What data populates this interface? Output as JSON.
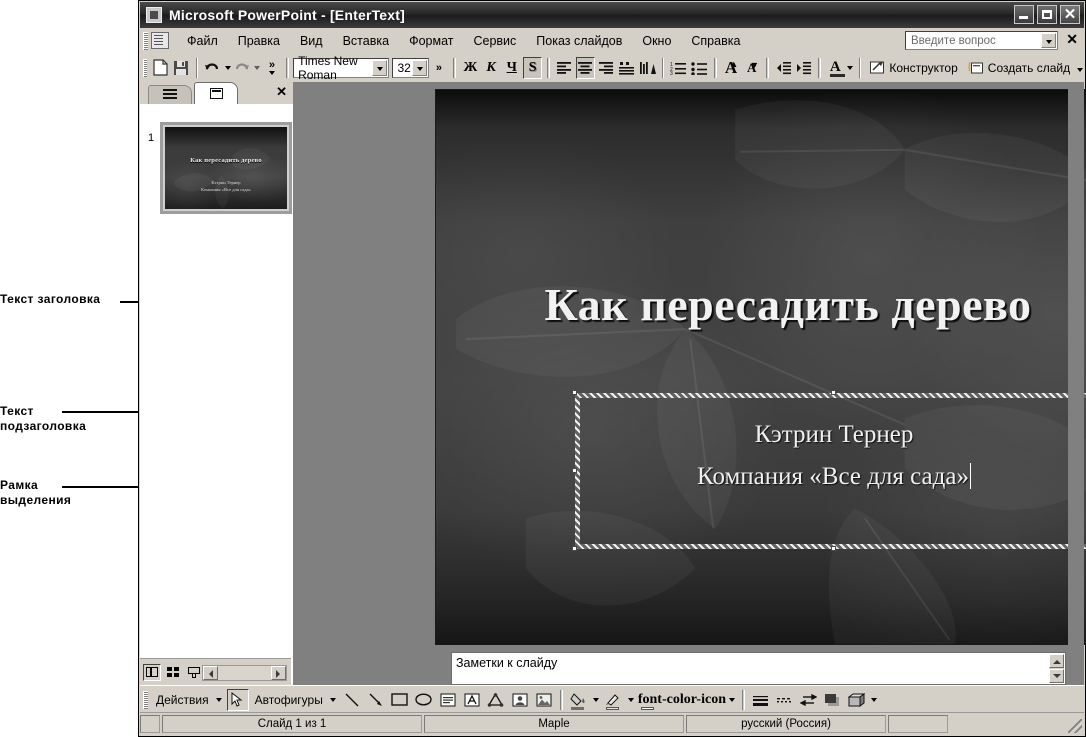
{
  "window": {
    "title": "Microsoft PowerPoint - [EnterText]",
    "app_icon": "powerpoint-icon",
    "minimize": "_",
    "maximize": "□",
    "close": "✕"
  },
  "menu": {
    "items": [
      {
        "label": "Файл"
      },
      {
        "label": "Правка"
      },
      {
        "label": "Вид"
      },
      {
        "label": "Вставка"
      },
      {
        "label": "Формат"
      },
      {
        "label": "Сервис"
      },
      {
        "label": "Показ слайдов"
      },
      {
        "label": "Окно"
      },
      {
        "label": "Справка"
      }
    ],
    "ask_box_placeholder": "Введите вопрос",
    "close_label": "✕"
  },
  "toolbar": {
    "new_icon": "new-document-icon",
    "save_icon": "save-icon",
    "undo_icon": "undo-icon",
    "redo_icon": "redo-icon",
    "overflow_label": "»",
    "font_name": "Times New Roman",
    "font_size": "32",
    "bold_label": "Ж",
    "italic_label": "К",
    "underline_label": "Ч",
    "shadow_label": "S",
    "align_left_icon": "align-left-icon",
    "align_center_icon": "align-center-icon",
    "align_right_icon": "align-right-icon",
    "line_spacing_icon": "line-spacing-icon",
    "text_direction_icon": "text-direction-icon",
    "numbered_list_icon": "numbered-list-icon",
    "bulleted_list_icon": "bulleted-list-icon",
    "increase_font_label": "A",
    "decrease_font_label": "A",
    "decrease_indent_icon": "decrease-indent-icon",
    "increase_indent_icon": "increase-indent-icon",
    "font_color_label": "A",
    "design_label": "Конструктор",
    "new_slide_label": "Создать слайд"
  },
  "left_pane": {
    "tab_outline_icon": "outline-tab-icon",
    "tab_slides_icon": "slides-tab-icon",
    "close_label": "✕",
    "slide_number": "1",
    "thumbnail": {
      "title": "Как пересадить дерево",
      "subtitle_line1": "Кэтрин Тернер",
      "subtitle_line2": "Компания «Все для сада»"
    },
    "view_normal_icon": "view-normal-icon",
    "view_sorter_icon": "view-slide-sorter-icon",
    "view_show_icon": "view-slideshow-icon"
  },
  "slide": {
    "title": "Как пересадить дерево",
    "subtitle_line1": "Кэтрин Тернер",
    "subtitle_line2": "Компания «Все для сада»"
  },
  "notes": {
    "placeholder": "Заметки к слайду"
  },
  "drawing_toolbar": {
    "actions_label": "Действия",
    "select_icon": "select-arrow-icon",
    "autoshapes_label": "Автофигуры",
    "line_icon": "line-icon",
    "arrow_icon": "arrow-icon",
    "rectangle_icon": "rectangle-icon",
    "oval_icon": "oval-icon",
    "textbox_icon": "text-box-icon",
    "wordart_icon": "wordart-icon",
    "diagram_icon": "diagram-icon",
    "clipart_icon": "clip-art-icon",
    "picture_icon": "insert-picture-icon",
    "fill_color_icon": "fill-color-icon",
    "line_color_icon": "line-color-icon",
    "font_color_icon": "font-color-icon",
    "line_style_icon": "line-style-icon",
    "dash_style_icon": "dash-style-icon",
    "arrow_style_icon": "arrow-style-icon",
    "shadow_icon": "shadow-style-icon",
    "3d_icon": "3d-style-icon"
  },
  "status_bar": {
    "slide_counter": "Слайд 1 из 1",
    "design_name": "Maple",
    "language": "русский (Россия)"
  },
  "annotations": [
    {
      "id": "title-text",
      "label": "Текст заголовка"
    },
    {
      "id": "subtitle-text",
      "label": "Текст\nподзаголовка"
    },
    {
      "id": "selection-frame",
      "label": "Рамка\nвыделения"
    }
  ]
}
